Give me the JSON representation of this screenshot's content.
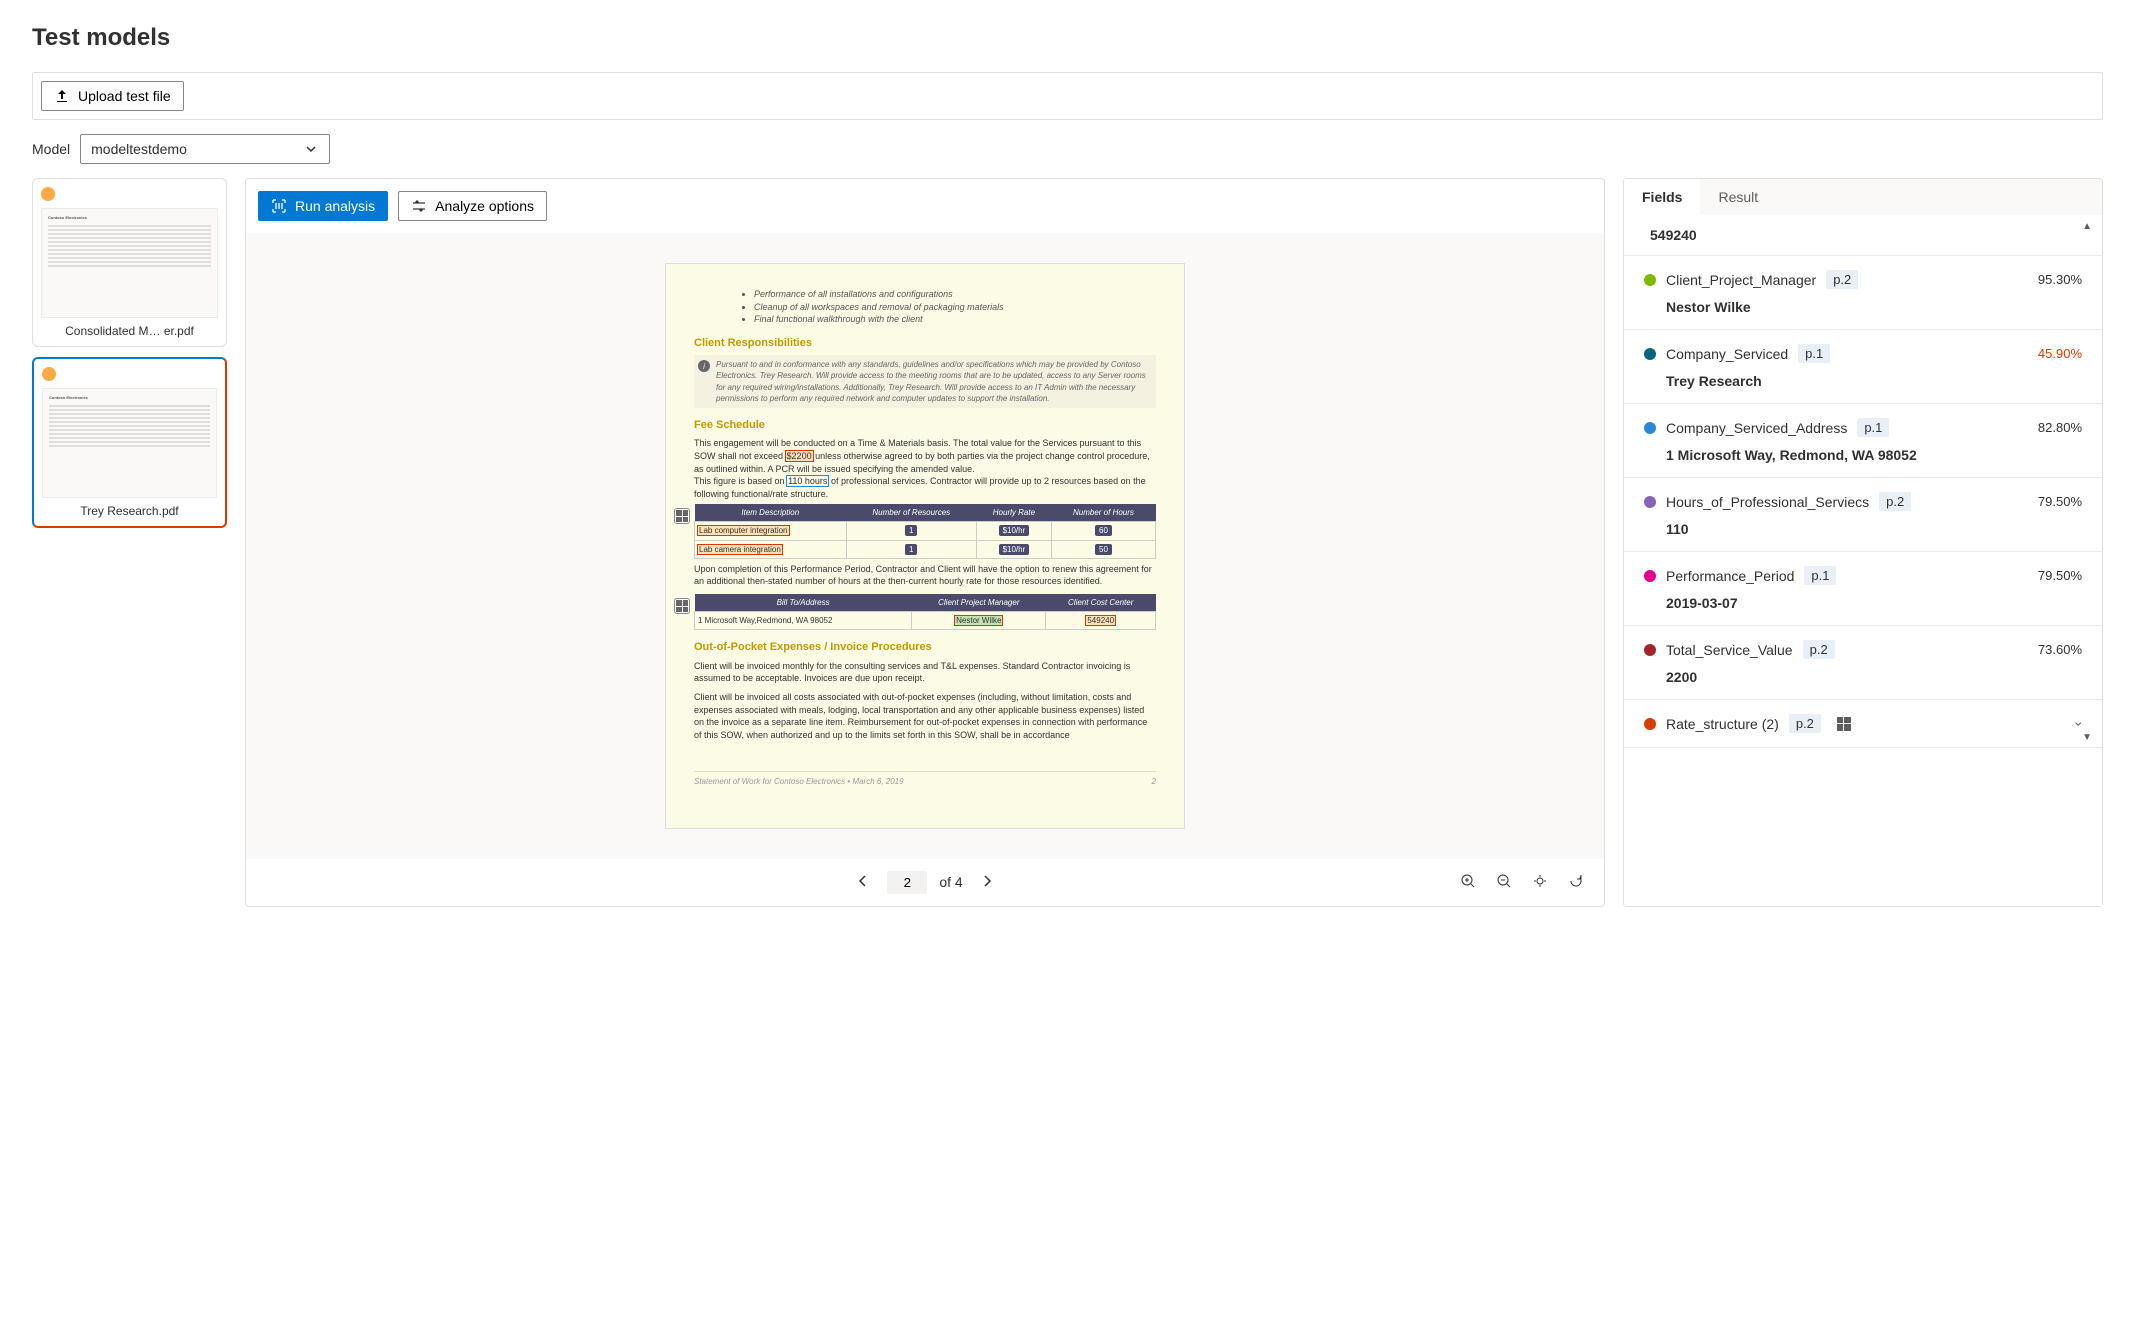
{
  "page": {
    "title": "Test models"
  },
  "toolbar": {
    "upload_label": "Upload test file",
    "model_label": "Model",
    "model_selected": "modeltestdemo",
    "run_label": "Run analysis",
    "options_label": "Analyze options"
  },
  "thumbnails": [
    {
      "label": "Consolidated M… er.pdf",
      "selected": false
    },
    {
      "label": "Trey Research.pdf",
      "selected": true
    }
  ],
  "colors": {
    "client_pm": "#7cbb00",
    "company_serviced": "#00667f",
    "address": "#2b88d8",
    "hours": "#8764b8",
    "perf_period": "#e3008c",
    "total_value": "#a4262c",
    "rate_structure": "#d83b01"
  },
  "viewer": {
    "page_current": "2",
    "page_of": "of 4",
    "doc": {
      "bullets": [
        "Performance of all installations and configurations",
        "Cleanup of all workspaces and removal of packaging materials",
        "Final functional walkthrough with the client"
      ],
      "h_client_resp": "Client Responsibilities",
      "client_resp_text": "Pursuant to and in conformance with any standards, guidelines and/or specifications which may be provided by Contoso Electronics. Trey Research. Will provide access to the meeting rooms that are to be updated, access to any Server rooms for any required wiring/installations. Additionally, Trey Research. Will provide access to an IT Admin with the necessary permissions to perform any required network and computer updates to support the installation.",
      "h_fee": "Fee Schedule",
      "fee_p1a": "This engagement will be conducted on a Time & Materials basis. The total value for the Services pursuant to this SOW shall not exceed ",
      "fee_total": "$2200",
      "fee_p1b": " unless otherwise agreed to by both parties via the project change control procedure, as outlined within. A PCR will be issued specifying the amended value.",
      "fee_p2a": "This figure is based on ",
      "fee_hours": "110 hours",
      "fee_p2b": " of professional services. Contractor will provide up to 2 resources based on the following functional/rate structure.",
      "rate_table": {
        "headers": [
          "Item Description",
          "Number of Resources",
          "Hourly Rate",
          "Number of Hours"
        ],
        "rows": [
          [
            "Lab computer integration",
            "1",
            "$10/hr",
            "60"
          ],
          [
            "Lab camera integration",
            "1",
            "$10/hr",
            "50"
          ]
        ]
      },
      "fee_p3": "Upon completion of this Performance Period, Contractor and Client will have the option to renew this agreement for an additional then-stated number of hours at the then-current hourly rate for those resources identified.",
      "bill_table": {
        "headers": [
          "Bill To/Address",
          "Client Project Manager",
          "Client Cost Center"
        ],
        "rows": [
          [
            "1 Microsoft Way,Redmond, WA 98052",
            "Nestor Wilke",
            "549240"
          ]
        ]
      },
      "h_oop": "Out-of-Pocket Expenses / Invoice Procedures",
      "oop_p1": "Client will be invoiced monthly for the consulting services and T&L expenses. Standard Contractor invoicing is assumed to be acceptable. Invoices are due upon receipt.",
      "oop_p2": "Client will be invoiced all costs associated with out-of-pocket expenses (including, without limitation, costs and expenses associated with meals, lodging, local transportation and any other applicable business expenses) listed on the invoice as a separate line item. Reimbursement for out-of-pocket expenses in connection with performance of this SOW, when authorized and up to the limits set forth in this SOW, shall be in accordance",
      "footer_left": "Statement of Work for Contoso Electronics • March 6, 2019",
      "footer_right": "2"
    }
  },
  "panel": {
    "tab_fields": "Fields",
    "tab_result": "Result",
    "top_value": "549240",
    "fields": [
      {
        "color": "client_pm",
        "name": "Client_Project_Manager",
        "page": "p.2",
        "conf": "95.30%",
        "low": false,
        "value": "Nestor Wilke"
      },
      {
        "color": "company_serviced",
        "name": "Company_Serviced",
        "page": "p.1",
        "conf": "45.90%",
        "low": true,
        "value": "Trey Research"
      },
      {
        "color": "address",
        "name": "Company_Serviced_Address",
        "page": "p.1",
        "conf": "82.80%",
        "low": false,
        "value": "1 Microsoft Way, Redmond, WA 98052"
      },
      {
        "color": "hours",
        "name": "Hours_of_Professional_Serviecs",
        "page": "p.2",
        "conf": "79.50%",
        "low": false,
        "value": "110"
      },
      {
        "color": "perf_period",
        "name": "Performance_Period",
        "page": "p.1",
        "conf": "79.50%",
        "low": false,
        "value": "2019-03-07"
      },
      {
        "color": "total_value",
        "name": "Total_Service_Value",
        "page": "p.2",
        "conf": "73.60%",
        "low": false,
        "value": "2200"
      }
    ],
    "rate_field": {
      "name": "Rate_structure (2)",
      "page": "p.2"
    }
  }
}
